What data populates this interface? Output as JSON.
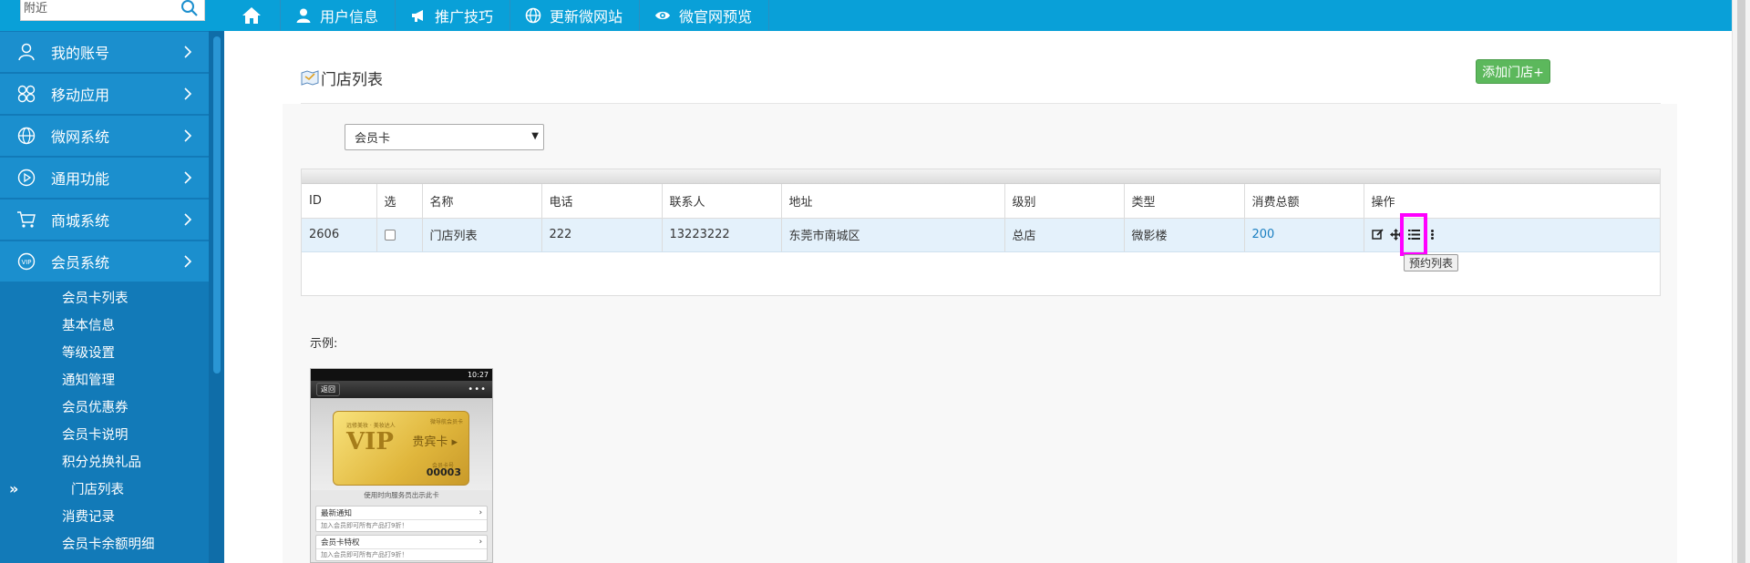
{
  "search": {
    "placeholder": "附近"
  },
  "topnav": {
    "items": [
      {
        "label": "用户信息",
        "icon": "user-icon"
      },
      {
        "label": "推广技巧",
        "icon": "megaphone-icon"
      },
      {
        "label": "更新微网站",
        "icon": "globe-icon"
      },
      {
        "label": "微官网预览",
        "icon": "eye-icon"
      }
    ]
  },
  "sidebar": {
    "menu": [
      {
        "label": "我的账号",
        "icon": "user-icon"
      },
      {
        "label": "移动应用",
        "icon": "apps-icon"
      },
      {
        "label": "微网系统",
        "icon": "globe-icon"
      },
      {
        "label": "通用功能",
        "icon": "play-icon"
      },
      {
        "label": "商城系统",
        "icon": "cart-icon"
      },
      {
        "label": "会员系统",
        "icon": "vip-icon"
      }
    ],
    "submenu": [
      "会员卡列表",
      "基本信息",
      "等级设置",
      "通知管理",
      "会员优惠券",
      "会员卡说明",
      "积分兑换礼品",
      "门店列表",
      "消费记录",
      "会员卡余额明细"
    ],
    "active_index": 7,
    "active_marker": "»"
  },
  "page": {
    "title": "门店列表",
    "add_button": "添加门店+",
    "filter_select": "会员卡",
    "example_label": "示例:"
  },
  "table": {
    "headers": [
      "ID",
      "选",
      "名称",
      "电话",
      "联系人",
      "地址",
      "级别",
      "类型",
      "消费总额",
      "操作"
    ],
    "rows": [
      {
        "id": "2606",
        "name": "门店列表",
        "phone": "222",
        "contact": "13223222",
        "address": "东莞市南城区",
        "level": "总店",
        "type": "微影楼",
        "total": "200"
      }
    ],
    "tooltip": "预约列表"
  },
  "phone_example": {
    "status_time": "10:27",
    "back": "返回",
    "more": "•••",
    "card_small_left": "远修美妆 · 美妆达人",
    "card_small_right": "微导航会员卡",
    "card_vip": "VIP",
    "card_gold": "贵宾卡 ▸",
    "card_no_label": "会员卡号",
    "card_no": "00003",
    "hint": "使用时向服务员出示此卡",
    "blocks": [
      {
        "title": "最新通知",
        "sub": "加入会员即可所有产品打9折！"
      },
      {
        "title": "会员卡特权",
        "sub": "加入会员即可所有产品打9折！"
      }
    ]
  },
  "colors": {
    "topbar": "#09a0d8",
    "sidebar": "#127ab8",
    "menu_item": "#1b8fce",
    "add_button": "#5cb85c",
    "highlight": "#ff00ff"
  }
}
